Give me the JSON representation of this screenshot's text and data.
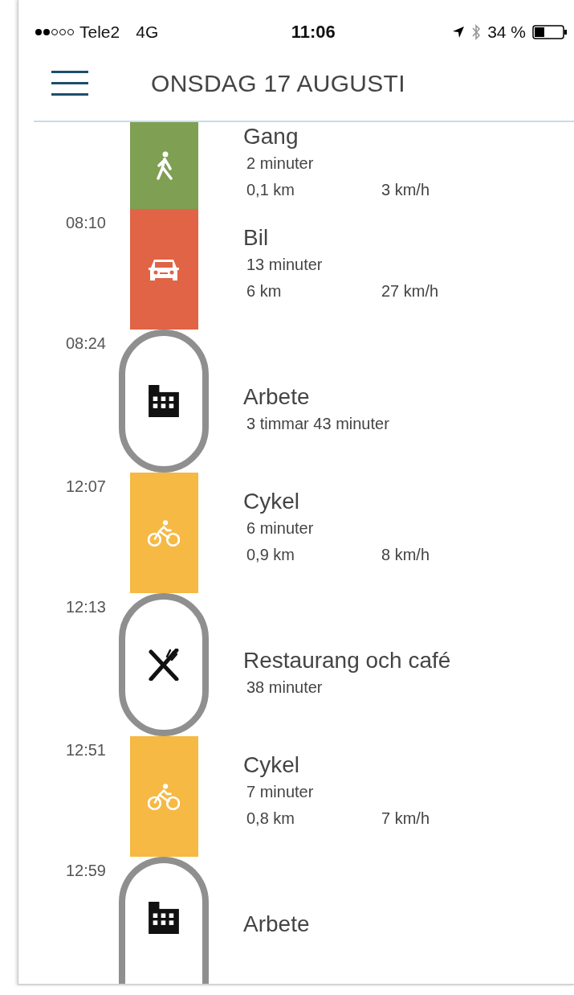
{
  "status_bar": {
    "carrier": "Tele2",
    "network": "4G",
    "time": "11:06",
    "battery": "34 %"
  },
  "header": {
    "title": "ONSDAG 17 AUGUSTI"
  },
  "timeline": [
    {
      "kind": "walking",
      "color": "#7f9f52",
      "title": "Gang",
      "duration": "2 minuter",
      "distance": "0,1 km",
      "speed": "3 km/h"
    },
    {
      "kind": "driving",
      "color": "#e06445",
      "start_time": "08:10",
      "title": "Bil",
      "duration": "13 minuter",
      "distance": "6 km",
      "speed": "27 km/h"
    },
    {
      "kind": "work",
      "start_time": "08:24",
      "title": "Arbete",
      "duration": "3 timmar 43 minuter"
    },
    {
      "kind": "cycling",
      "color": "#f6b944",
      "start_time": "12:07",
      "title": "Cykel",
      "duration": "6 minuter",
      "distance": "0,9 km",
      "speed": "8 km/h"
    },
    {
      "kind": "restaurant",
      "start_time": "12:13",
      "title": "Restaurang och café",
      "duration": "38 minuter"
    },
    {
      "kind": "cycling",
      "color": "#f6b944",
      "start_time": "12:51",
      "title": "Cykel",
      "duration": "7 minuter",
      "distance": "0,8 km",
      "speed": "7 km/h"
    },
    {
      "kind": "work",
      "start_time": "12:59",
      "title": "Arbete"
    }
  ]
}
